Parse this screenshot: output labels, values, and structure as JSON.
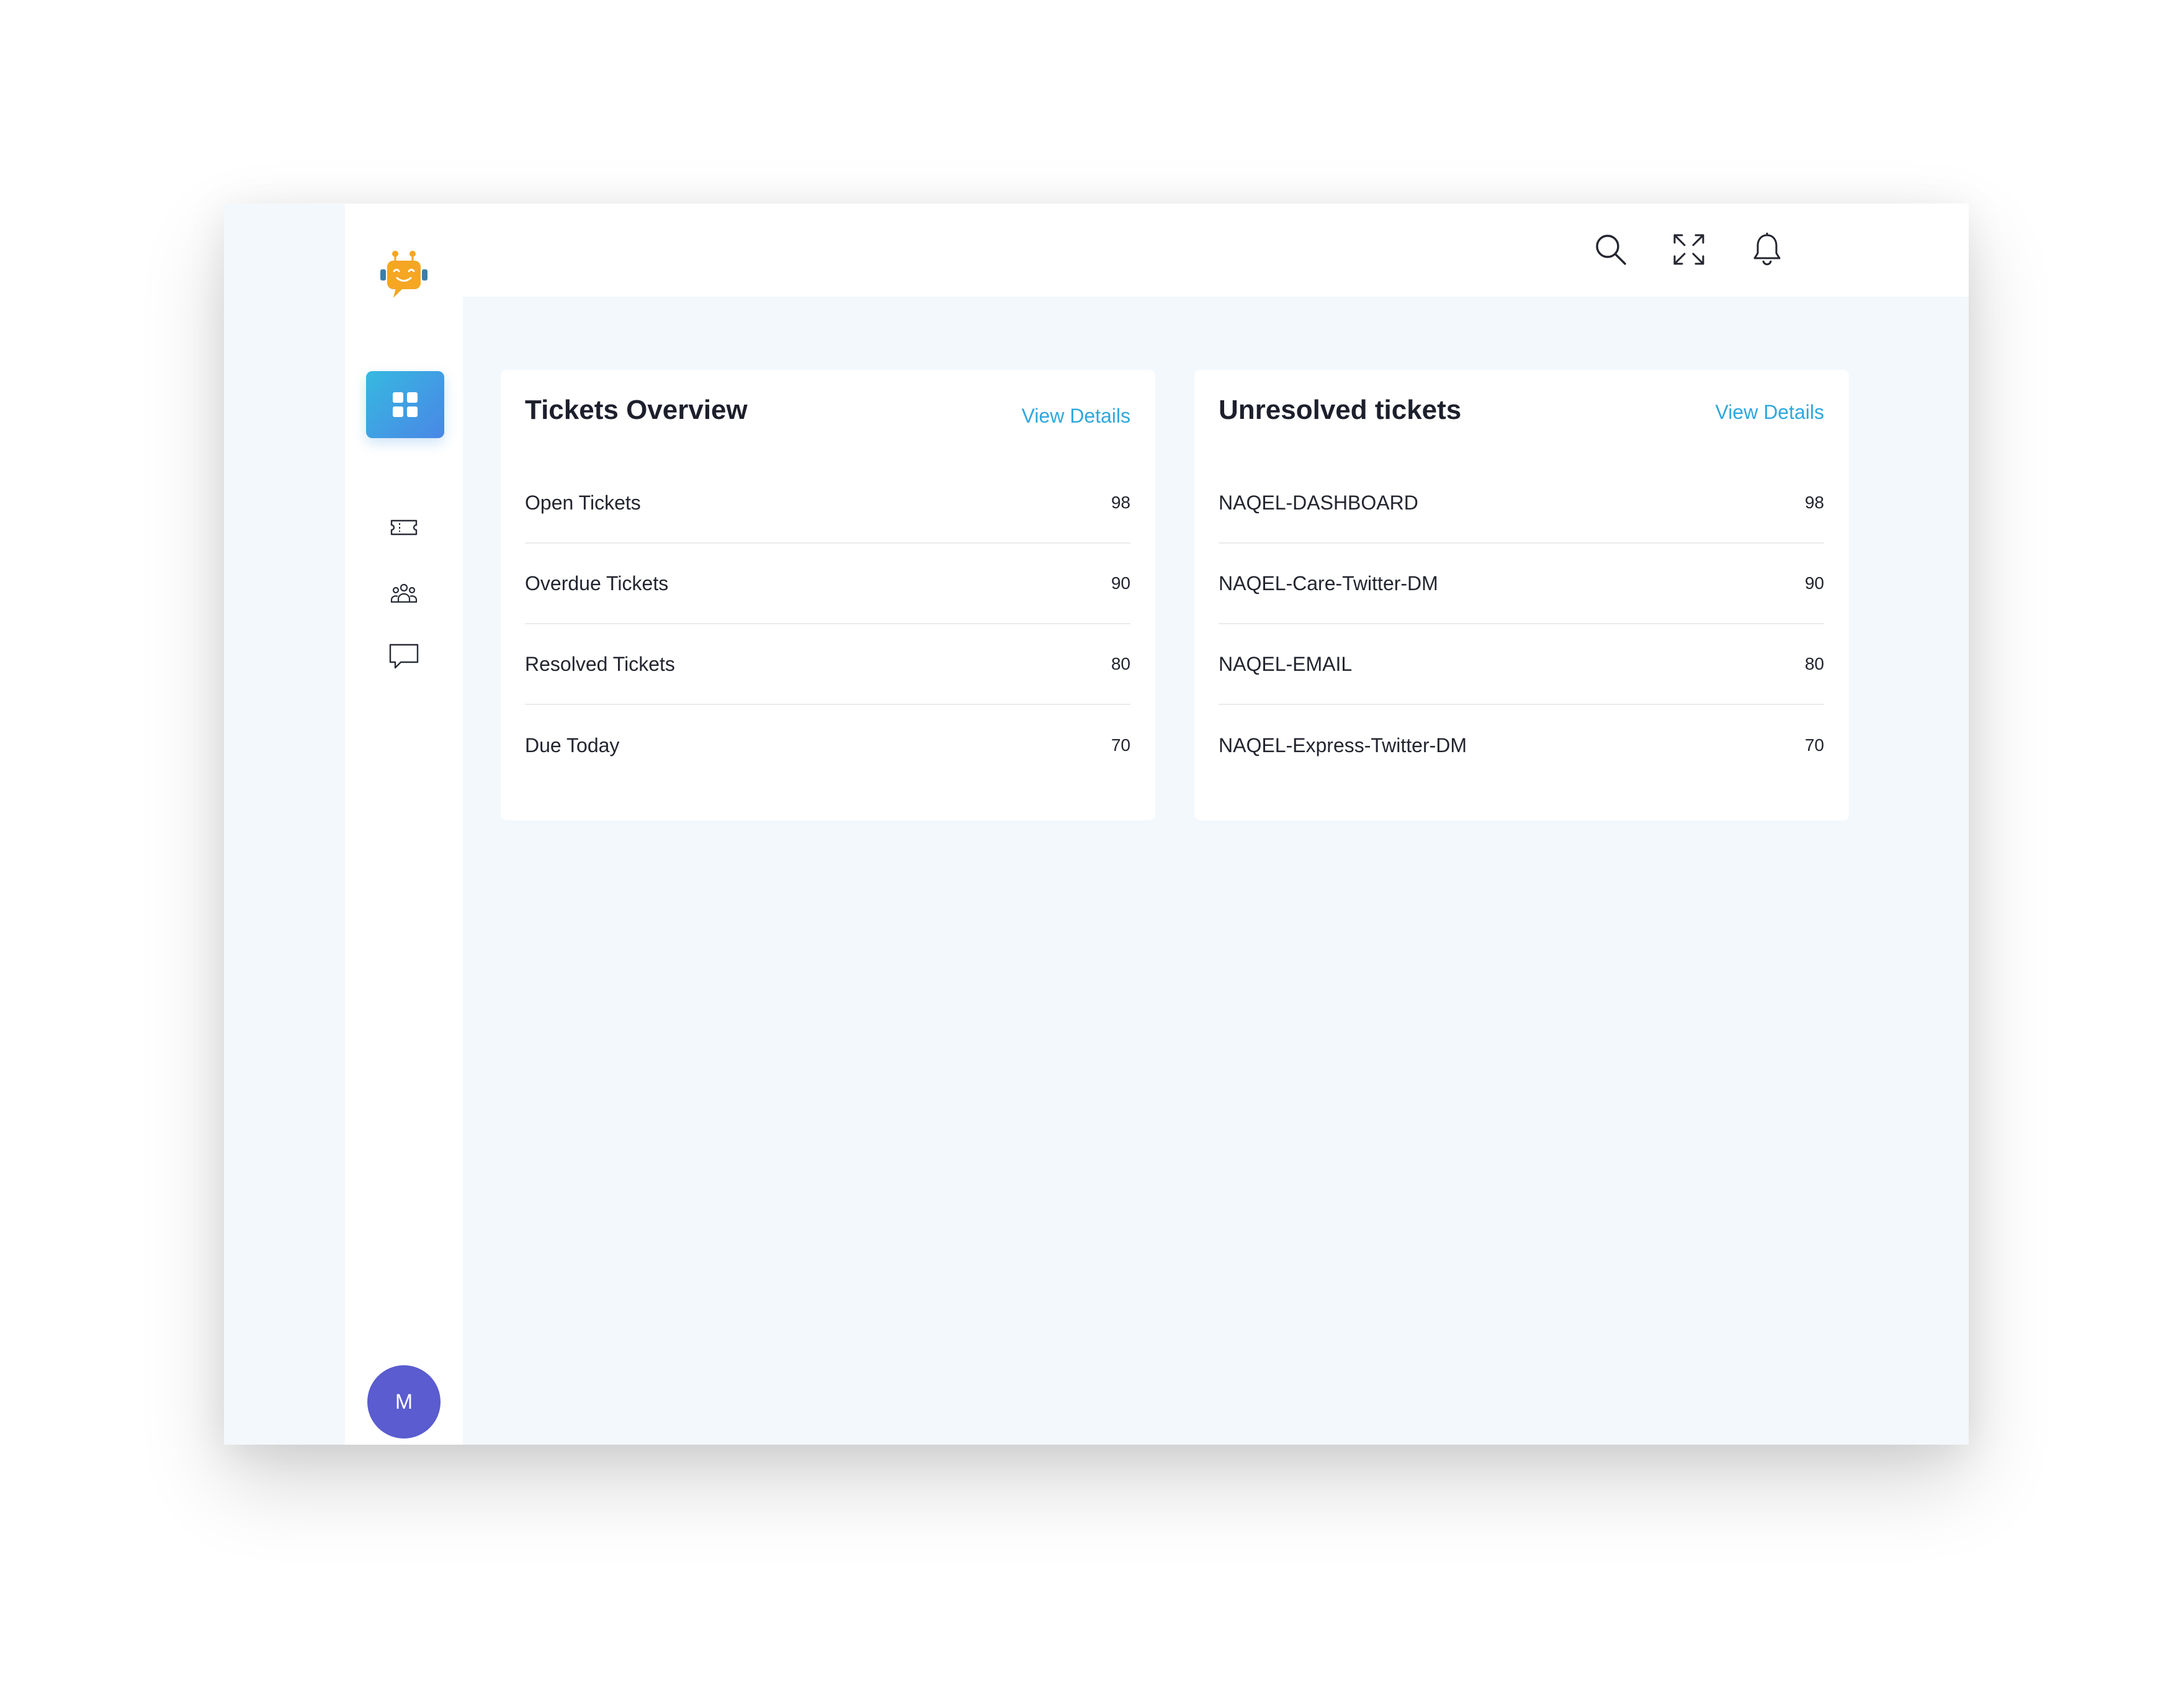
{
  "sidebar": {
    "logo": "robot-support-logo",
    "items": [
      {
        "icon": "dashboard-grid-icon",
        "active": true
      },
      {
        "icon": "ticket-icon",
        "active": false
      },
      {
        "icon": "users-group-icon",
        "active": false
      },
      {
        "icon": "chat-icon",
        "active": false
      }
    ],
    "avatar_initial": "M"
  },
  "header": {
    "icons": [
      "search-icon",
      "fullscreen-icon",
      "bell-icon"
    ]
  },
  "tickets_overview": {
    "title": "Tickets Overview",
    "link": "View Details",
    "rows": [
      {
        "label": "Open Tickets",
        "value": "98"
      },
      {
        "label": "Overdue Tickets",
        "value": "90"
      },
      {
        "label": "Resolved Tickets",
        "value": "80"
      },
      {
        "label": "Due Today",
        "value": "70"
      }
    ]
  },
  "unresolved_tickets": {
    "title": "Unresolved tickets",
    "link": "View Details",
    "rows": [
      {
        "label": "NAQEL-DASHBOARD",
        "value": "98"
      },
      {
        "label": "NAQEL-Care-Twitter-DM",
        "value": "90"
      },
      {
        "label": "NAQEL-EMAIL",
        "value": "80"
      },
      {
        "label": "NAQEL-Express-Twitter-DM",
        "value": "70"
      }
    ]
  },
  "colors": {
    "accent": "#2fa7de",
    "gradient_start": "#36b9e0",
    "gradient_end": "#4a86e6",
    "avatar": "#5a5ccf",
    "background": "#f3f8fc",
    "logo": "#f5a623"
  }
}
